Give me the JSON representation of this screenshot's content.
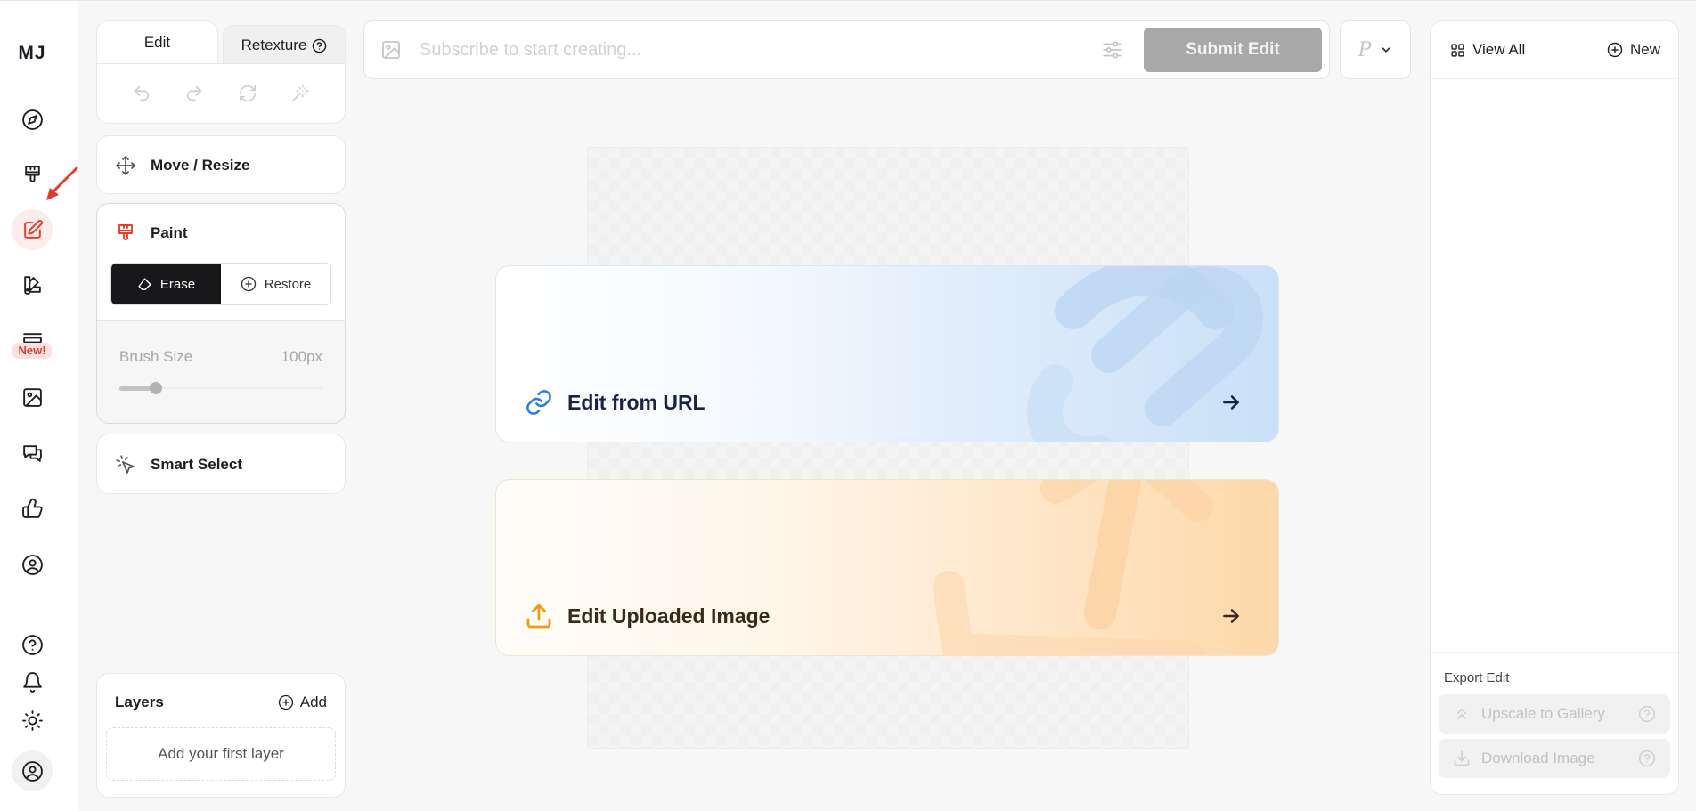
{
  "rail": {
    "logo": "MJ",
    "items": [
      {
        "name": "explore",
        "icon": "compass-icon"
      },
      {
        "name": "create",
        "icon": "paintbrush-icon"
      },
      {
        "name": "edit",
        "icon": "edit-icon",
        "active": true
      },
      {
        "name": "personalize",
        "icon": "palette-icon"
      },
      {
        "name": "moodboards",
        "icon": "layout-icon",
        "badge": "New!"
      },
      {
        "name": "organize",
        "icon": "image-icon"
      },
      {
        "name": "chat",
        "icon": "chat-icon"
      },
      {
        "name": "rate",
        "icon": "thumbs-up-icon"
      },
      {
        "name": "profile",
        "icon": "user-circle-icon"
      },
      {
        "name": "help",
        "icon": "help-icon"
      },
      {
        "name": "notifications",
        "icon": "bell-icon"
      },
      {
        "name": "theme",
        "icon": "sun-icon"
      },
      {
        "name": "account",
        "icon": "account-icon"
      }
    ],
    "new_badge": "New!"
  },
  "tool_panel": {
    "tabs": {
      "edit": "Edit",
      "retexture": "Retexture"
    },
    "move_resize": "Move / Resize",
    "paint": {
      "label": "Paint",
      "erase": "Erase",
      "restore": "Restore",
      "brush_size_label": "Brush Size",
      "brush_size_value": "100px",
      "brush_fraction": 0.18
    },
    "smart_select": "Smart Select",
    "layers": {
      "title": "Layers",
      "add": "Add",
      "empty": "Add your first layer"
    }
  },
  "prompt_bar": {
    "placeholder": "Subscribe to start creating...",
    "submit": "Submit Edit",
    "selector_value": "P"
  },
  "canvas": {
    "edit_from_url": "Edit from URL",
    "edit_uploaded": "Edit Uploaded Image"
  },
  "right_panel": {
    "view_all": "View All",
    "new": "New",
    "export_label": "Export Edit",
    "upscale": "Upscale to Gallery",
    "download": "Download Image"
  },
  "colors": {
    "accent_red": "#e4402b",
    "link_blue": "#2b7fd8",
    "upload_orange": "#f19a18",
    "submit_disabled": "#a8a8a8"
  }
}
